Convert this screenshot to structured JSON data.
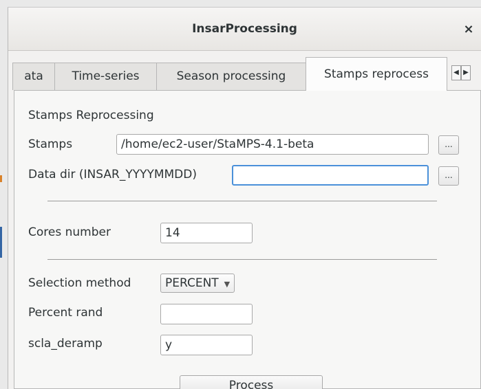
{
  "window": {
    "title": "InsarProcessing",
    "close_symbol": "×"
  },
  "tabs": [
    {
      "label": "ata",
      "active": false
    },
    {
      "label": "Time-series",
      "active": false
    },
    {
      "label": "Season processing",
      "active": false
    },
    {
      "label": "Stamps reprocess",
      "active": true
    }
  ],
  "tab_scroll": {
    "left": "◀",
    "right": "▶"
  },
  "panel": {
    "section_title": "Stamps Reprocessing",
    "stamps": {
      "label": "Stamps",
      "value": "/home/ec2-user/StaMPS-4.1-beta",
      "browse_label": "..."
    },
    "data_dir": {
      "label": "Data dir (INSAR_YYYYMMDD)",
      "value": "",
      "browse_label": "..."
    },
    "cores": {
      "label": "Cores number",
      "value": "14"
    },
    "selection_method": {
      "label": "Selection method",
      "value": "PERCENT",
      "arrow": "▼"
    },
    "percent_rand": {
      "label": "Percent rand",
      "value": ""
    },
    "scla_deramp": {
      "label": "scla_deramp",
      "value": "y"
    },
    "process_label": "Process"
  }
}
